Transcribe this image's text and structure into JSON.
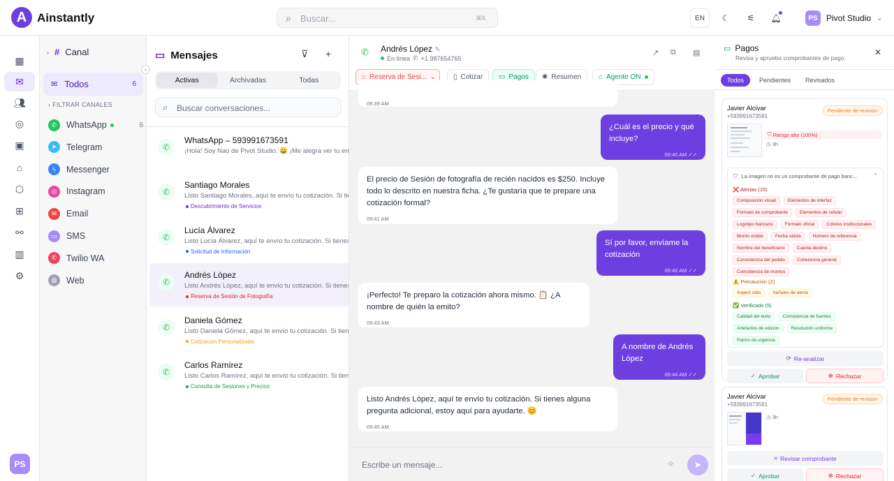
{
  "app": {
    "logo_letter": "A",
    "brand": "Ainstantly"
  },
  "topbar": {
    "search_placeholder": "Buscar...",
    "search_kbd": "⌘K",
    "lang": "EN",
    "profile_initials": "PS",
    "profile_name": "Pivot Studio"
  },
  "rail": {
    "avatar_initials": "PS"
  },
  "channels": {
    "title": "Canal",
    "all_label": "Todos",
    "all_count": "6",
    "filter_label": "FILTRAR CANALES",
    "items": [
      {
        "label": "WhatsApp",
        "count": "6",
        "color": "#22c55e",
        "glyph": "✆",
        "online": true
      },
      {
        "label": "Telegram",
        "count": "",
        "color": "#38bdf8",
        "glyph": "➤"
      },
      {
        "label": "Messenger",
        "count": "",
        "color": "#3b82f6",
        "glyph": "ϟ"
      },
      {
        "label": "Instagram",
        "count": "",
        "color": "#ec4899",
        "glyph": "◎"
      },
      {
        "label": "Email",
        "count": "",
        "color": "#ef4444",
        "glyph": "✉"
      },
      {
        "label": "SMS",
        "count": "",
        "color": "#a78bfa",
        "glyph": "▭"
      },
      {
        "label": "Twilio WA",
        "count": "",
        "color": "#f43f5e",
        "glyph": "✆"
      },
      {
        "label": "Web",
        "count": "",
        "color": "#9ca3af",
        "glyph": "◍"
      }
    ]
  },
  "conversations": {
    "title": "Mensajes",
    "tabs": [
      "Activas",
      "Archivadas",
      "Todas"
    ],
    "search_placeholder": "Buscar conversaciones...",
    "items": [
      {
        "name": "WhatsApp – 593991673591",
        "preview": "¡Hola! Soy Nao de Pivot Studio. 😀 ¡Me alegra ver tu entusiasmo",
        "tag": "",
        "tag_color": ""
      },
      {
        "name": "Santiago Morales",
        "preview": "Listo Santiago Morales, aquí te envío tu cotización. Si tienes alguna",
        "tag": "Descubrimiento de Servicios",
        "tag_color": "#6d28d9"
      },
      {
        "name": "Lucía Álvarez",
        "preview": "Listo Lucía Álvarez, aquí te envío tu cotización. Si tienes alguna",
        "tag": "Solicitud de Información",
        "tag_color": "#2563eb"
      },
      {
        "name": "Andrés López",
        "preview": "Listo Andrés López, aquí te envío tu cotización. Si tienes alguna",
        "tag": "Reserva de Sesión de Fotografía",
        "tag_color": "#dc2626"
      },
      {
        "name": "Daniela Gómez",
        "preview": "Listo Daniela Gómez, aquí te envío tu cotización. Si tienes alguna",
        "tag": "Cotización Personalizada",
        "tag_color": "#f59e0b"
      },
      {
        "name": "Carlos Ramírez",
        "preview": "Listo Carlos Ramírez, aquí te envío tu cotización. Si tienes alguna",
        "tag": "Consulta de Sesiones y Precios",
        "tag_color": "#16a34a"
      }
    ]
  },
  "chat": {
    "contact_name": "Andrés López",
    "status": "En línea",
    "phone": "+1 987654765",
    "pills": {
      "stage": "Reserva de Sesi...",
      "quote": "Cotizar",
      "payments": "Pagos",
      "summary": "Resumen",
      "agent": "Agente ON"
    },
    "messages": [
      {
        "dir": "in",
        "text": "",
        "time": "09:39 AM"
      },
      {
        "dir": "out",
        "text": "¿Cuál es el precio y qué incluye?",
        "time": "09:40 AM"
      },
      {
        "dir": "in",
        "text": "El precio de Sesión de fotografía de recién nacidos es $250. Incluye todo lo descrito en nuestra ficha. ¿Te gustaría que te prepare una cotización formal?",
        "time": "09:41 AM"
      },
      {
        "dir": "out",
        "text": "Sí por favor, envíame la cotización",
        "time": "09:42 AM"
      },
      {
        "dir": "in",
        "text": "¡Perfecto! Te preparo la cotización ahora mismo. 📋 ¿A nombre de quién la emito?",
        "time": "09:43 AM"
      },
      {
        "dir": "out",
        "text": "A nombre de Andrés López",
        "time": "09:44 AM"
      },
      {
        "dir": "in",
        "text": "Listo Andrés López, aquí te envío tu cotización. Si tienes alguna pregunta adicional, estoy aquí para ayudarte. 😊",
        "time": "09:45 AM"
      }
    ],
    "composer_placeholder": "Escribe un mensaje..."
  },
  "payments": {
    "title": "Pagos",
    "subtitle": "Revisa y aprueba comprobantes de pago.",
    "tabs": [
      "Todos",
      "Pendientes",
      "Revisados"
    ],
    "card1": {
      "name": "Javier Alcivar",
      "phone": "+593991673591",
      "status": "Pendiente de revisión",
      "risk": "Riesgo alto (100%)",
      "age": "3h",
      "analysis_title": "La imagen no es un comprobante de pago banc...",
      "alerts_title": "❌ Alertas (15)",
      "alerts": [
        "Composición visual",
        "Elementos de interfaz",
        "Formato de comprobante",
        "Elementos de celular",
        "Logotipo bancario",
        "Formato oficial",
        "Colores institucionales",
        "Monto visible",
        "Fecha válida",
        "Número de referencia",
        "Nombre del beneficiario",
        "Cuenta destino",
        "Consistencia del pedido",
        "Coherencia general",
        "Coincidencia de montos"
      ],
      "warn_title": "⚠️ Precaución (2)",
      "warnings": [
        "Aspect ratio",
        "Señales de alerta"
      ],
      "ok_title": "✅ Verificado (5)",
      "verified": [
        "Calidad del texto",
        "Consistencia de fuentes",
        "Artefactos de edición",
        "Resolución uniforme",
        "Patrón de urgencia"
      ],
      "reanalyze": "Re-analizar",
      "approve": "Aprobar",
      "reject": "Rechazar"
    },
    "card2": {
      "name": "Javier Alcivar",
      "phone": "+593991673591",
      "status": "Pendiente de revisión",
      "age": "3h",
      "review": "Revisar comprobante",
      "approve": "Aprobar",
      "reject": "Rechazar"
    }
  }
}
